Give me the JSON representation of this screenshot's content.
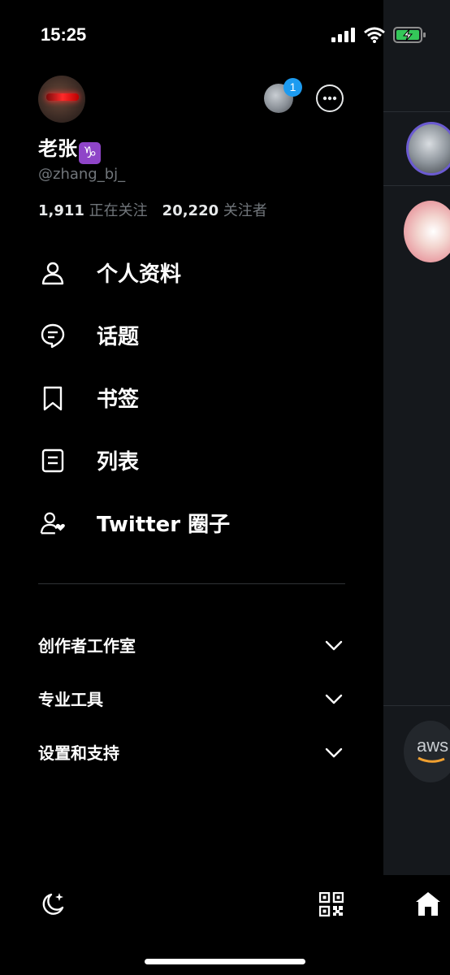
{
  "status_bar": {
    "time": "15:25"
  },
  "profile": {
    "display_name": "老张",
    "zodiac_glyph": "♑",
    "handle": "@zhang_bj_",
    "following_count": "1,911",
    "following_label": "正在关注",
    "followers_count": "20,220",
    "followers_label": "关注者",
    "account_switch_badge": "1"
  },
  "menu": {
    "items": [
      {
        "label": "个人资料",
        "icon": "person-icon"
      },
      {
        "label": "话题",
        "icon": "topics-icon"
      },
      {
        "label": "书签",
        "icon": "bookmark-icon"
      },
      {
        "label": "列表",
        "icon": "list-icon"
      },
      {
        "label": "Twitter 圈子",
        "icon": "circle-icon"
      }
    ]
  },
  "sections": [
    {
      "label": "创作者工作室"
    },
    {
      "label": "专业工具"
    },
    {
      "label": "设置和支持"
    }
  ],
  "background": {
    "aws_text": "aws"
  },
  "colors": {
    "accent": "#1d9bf0",
    "background": "#000000",
    "muted_text": "#71767b"
  }
}
